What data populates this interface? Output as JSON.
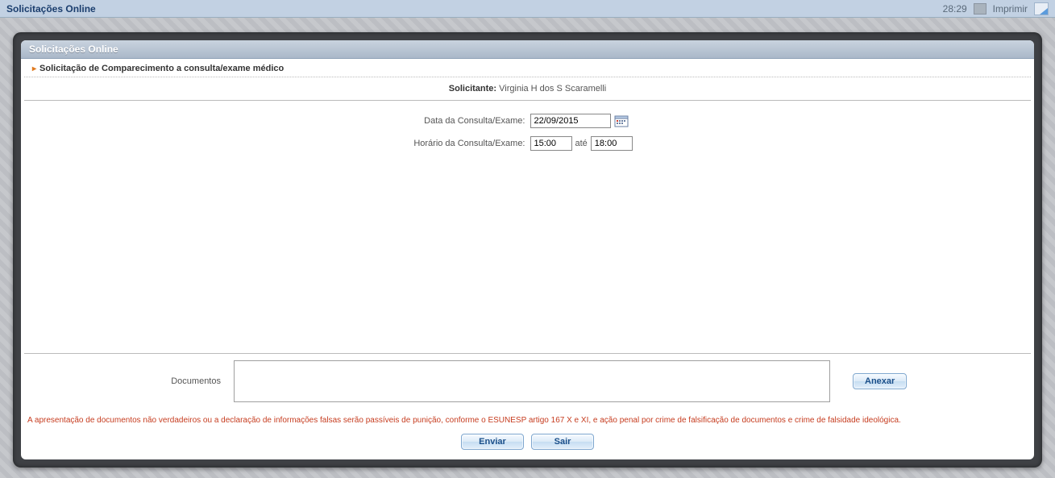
{
  "bg": {
    "title": "Solicitações Online",
    "time": "28:29",
    "print": "Imprimir"
  },
  "modal": {
    "title": "Solicitações Online",
    "section": "Solicitação de Comparecimento a consulta/exame médico",
    "solicitante_label": "Solicitante:",
    "solicitante_name": "Virginia H dos S Scaramelli",
    "date_label": "Data da Consulta/Exame:",
    "date_value": "22/09/2015",
    "time_label": "Horário da Consulta/Exame:",
    "time_from": "15:00",
    "time_sep": "até",
    "time_to": "18:00",
    "docs_label": "Documentos",
    "docs_value": "",
    "attach_btn": "Anexar",
    "warning": "A apresentação de documentos não verdadeiros ou a declaração de informações falsas serão passíveis de punição, conforme o ESUNESP artigo 167 X e XI, e ação penal por crime de falsificação de documentos e crime de falsidade ideológica.",
    "send_btn": "Enviar",
    "exit_btn": "Sair"
  }
}
